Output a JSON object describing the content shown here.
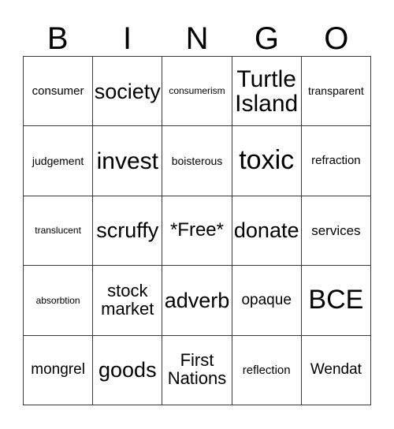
{
  "card": {
    "type": "bingo-card",
    "columns": 5,
    "rows": 5,
    "grid_color": "#3a3a3a",
    "background_color": "#ffffff",
    "text_color": "#000000"
  },
  "header": {
    "letters": [
      {
        "label": "B"
      },
      {
        "label": "I"
      },
      {
        "label": "N"
      },
      {
        "label": "G"
      },
      {
        "label": "O"
      }
    ]
  },
  "cells": [
    {
      "text": "consumer",
      "size": "fs-sm"
    },
    {
      "text": "society",
      "size": "fs-2xl"
    },
    {
      "text": "consumerism",
      "size": "fs-xs"
    },
    {
      "text": "Turtle\nIsland",
      "size": "fs-3xl"
    },
    {
      "text": "transparent",
      "size": "fs-s"
    },
    {
      "text": "judgement",
      "size": "fs-s"
    },
    {
      "text": "invest",
      "size": "fs-3xl"
    },
    {
      "text": "boisterous",
      "size": "fs-s"
    },
    {
      "text": "toxic",
      "size": "fs-4xl"
    },
    {
      "text": "refraction",
      "size": "fs-sm"
    },
    {
      "text": "translucent",
      "size": "fs-xs"
    },
    {
      "text": "scruffy",
      "size": "fs-2xl"
    },
    {
      "text": "*Free*",
      "size": "fs-xl"
    },
    {
      "text": "donate",
      "size": "fs-2xl"
    },
    {
      "text": "services",
      "size": "fs-m"
    },
    {
      "text": "absorbtion",
      "size": "fs-xs"
    },
    {
      "text": "stock\nmarket",
      "size": "fs-l"
    },
    {
      "text": "adverb",
      "size": "fs-2xl"
    },
    {
      "text": "opaque",
      "size": "fs-ml"
    },
    {
      "text": "BCE",
      "size": "fs-4xl"
    },
    {
      "text": "mongrel",
      "size": "fs-ml"
    },
    {
      "text": "goods",
      "size": "fs-2xl"
    },
    {
      "text": "First\nNations",
      "size": "fs-l"
    },
    {
      "text": "reflection",
      "size": "fs-sm"
    },
    {
      "text": "Wendat",
      "size": "fs-ml"
    }
  ]
}
